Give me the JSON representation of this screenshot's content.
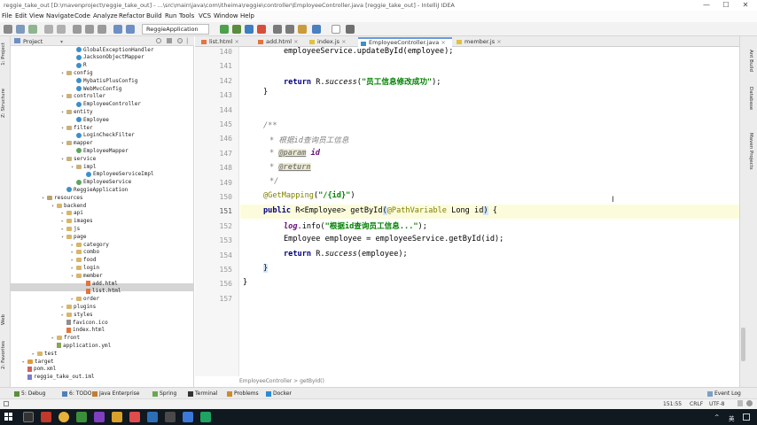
{
  "window": {
    "title": "reggie_take_out [D:\\mavenproject\\reggie_take_out] - ...\\src\\main\\java\\com\\itheima\\reggie\\controller\\EmployeeController.java [reggie_take_out] - IntelliJ IDEA"
  },
  "menu": [
    "File",
    "Edit",
    "View",
    "Navigate",
    "Code",
    "Analyze",
    "Refactor",
    "Build",
    "Run",
    "Tools",
    "VCS",
    "Window",
    "Help"
  ],
  "toolbar": {
    "run_config": "ReggieApplication"
  },
  "project": {
    "header": "Project",
    "tree": [
      {
        "label": "GlobalExceptionHandler",
        "icon": "cls",
        "indent": 6
      },
      {
        "label": "JacksonObjectMapper",
        "icon": "cls",
        "indent": 6
      },
      {
        "label": "R",
        "icon": "cls",
        "indent": 6
      },
      {
        "label": "config",
        "icon": "pkg",
        "indent": 5,
        "arrow": "v"
      },
      {
        "label": "MybatisPlusConfig",
        "icon": "cls",
        "indent": 6
      },
      {
        "label": "WebMvcConfig",
        "icon": "cls",
        "indent": 6
      },
      {
        "label": "controller",
        "icon": "pkg",
        "indent": 5,
        "arrow": "v"
      },
      {
        "label": "EmployeeController",
        "icon": "cls",
        "indent": 6
      },
      {
        "label": "entity",
        "icon": "pkg",
        "indent": 5,
        "arrow": "v"
      },
      {
        "label": "Employee",
        "icon": "cls",
        "indent": 6
      },
      {
        "label": "filter",
        "icon": "pkg",
        "indent": 5,
        "arrow": "v"
      },
      {
        "label": "LoginCheckFilter",
        "icon": "cls",
        "indent": 6
      },
      {
        "label": "mapper",
        "icon": "pkg",
        "indent": 5,
        "arrow": "v"
      },
      {
        "label": "EmployeeMapper",
        "icon": "iface",
        "indent": 6
      },
      {
        "label": "service",
        "icon": "pkg",
        "indent": 5,
        "arrow": "v"
      },
      {
        "label": "impl",
        "icon": "pkg",
        "indent": 6,
        "arrow": "v"
      },
      {
        "label": "EmployeeServiceImpl",
        "icon": "cls",
        "indent": 7
      },
      {
        "label": "EmployeeService",
        "icon": "iface",
        "indent": 6
      },
      {
        "label": "ReggieApplication",
        "icon": "cls",
        "indent": 5
      },
      {
        "label": "resources",
        "icon": "res",
        "indent": 3,
        "arrow": "v"
      },
      {
        "label": "backend",
        "icon": "folder",
        "indent": 4,
        "arrow": "v"
      },
      {
        "label": "api",
        "icon": "folder",
        "indent": 5,
        "arrow": ">"
      },
      {
        "label": "images",
        "icon": "folder",
        "indent": 5,
        "arrow": ">"
      },
      {
        "label": "js",
        "icon": "folder",
        "indent": 5,
        "arrow": ">"
      },
      {
        "label": "page",
        "icon": "folder",
        "indent": 5,
        "arrow": "v"
      },
      {
        "label": "category",
        "icon": "folder",
        "indent": 6,
        "arrow": ">"
      },
      {
        "label": "combo",
        "icon": "folder",
        "indent": 6,
        "arrow": ">"
      },
      {
        "label": "food",
        "icon": "folder",
        "indent": 6,
        "arrow": ">"
      },
      {
        "label": "login",
        "icon": "folder",
        "indent": 6,
        "arrow": ">"
      },
      {
        "label": "member",
        "icon": "folder",
        "indent": 6,
        "arrow": "v"
      },
      {
        "label": "add.html",
        "icon": "html",
        "indent": 7
      },
      {
        "label": "list.html",
        "icon": "html",
        "indent": 7
      },
      {
        "label": "order",
        "icon": "folder",
        "indent": 6,
        "arrow": ">"
      },
      {
        "label": "plugins",
        "icon": "folder",
        "indent": 5,
        "arrow": ">"
      },
      {
        "label": "styles",
        "icon": "folder",
        "indent": 5,
        "arrow": ">"
      },
      {
        "label": "favicon.ico",
        "icon": "ico-file",
        "indent": 5
      },
      {
        "label": "index.html",
        "icon": "html",
        "indent": 5
      },
      {
        "label": "front",
        "icon": "folder",
        "indent": 4,
        "arrow": ">"
      },
      {
        "label": "application.yml",
        "icon": "yml",
        "indent": 4
      },
      {
        "label": "test",
        "icon": "folder",
        "indent": 2,
        "arrow": ">"
      },
      {
        "label": "target",
        "icon": "target",
        "indent": 1,
        "arrow": ">"
      },
      {
        "label": "pom.xml",
        "icon": "xml",
        "indent": 1
      },
      {
        "label": "reggie_take_out.iml",
        "icon": "iml",
        "indent": 1
      }
    ]
  },
  "tabs": [
    {
      "label": "list.html",
      "icon": "html"
    },
    {
      "label": "add.html",
      "icon": "html"
    },
    {
      "label": "index.js",
      "icon": "js"
    },
    {
      "label": "EmployeeController.java",
      "icon": "cls",
      "active": true
    },
    {
      "label": "member.js",
      "icon": "js"
    }
  ],
  "editor": {
    "line_numbers": [
      "140",
      "141",
      "142",
      "143",
      "144",
      "145",
      "146",
      "147",
      "148",
      "149",
      "150",
      "151",
      "152",
      "153",
      "154",
      "155",
      "156",
      "157"
    ],
    "current_line": "151",
    "breadcrumb": "EmployeeController  >  getById()"
  },
  "left_strip": [
    "1: Project",
    "Z: Structure",
    "Web",
    "2: Favorites"
  ],
  "right_strip": [
    "Ant Build",
    "Database",
    "Maven Projects"
  ],
  "bottom_tools": [
    {
      "label": "5: Debug",
      "color": "#5a8f3c"
    },
    {
      "label": "6: TODO",
      "color": "#4f7fb8"
    },
    {
      "label": "Java Enterprise",
      "color": "#c27d32"
    },
    {
      "label": "Spring",
      "color": "#6aa84f"
    },
    {
      "label": "Terminal",
      "color": "#333333"
    },
    {
      "label": "Problems",
      "color": "#d08b2b"
    },
    {
      "label": "Docker",
      "color": "#2d8bd4"
    }
  ],
  "event_log": "Event Log",
  "status": {
    "position": "151:55",
    "line_sep": "CRLF",
    "encoding": "UTF-8"
  },
  "taskbar": {
    "lang": "英"
  }
}
